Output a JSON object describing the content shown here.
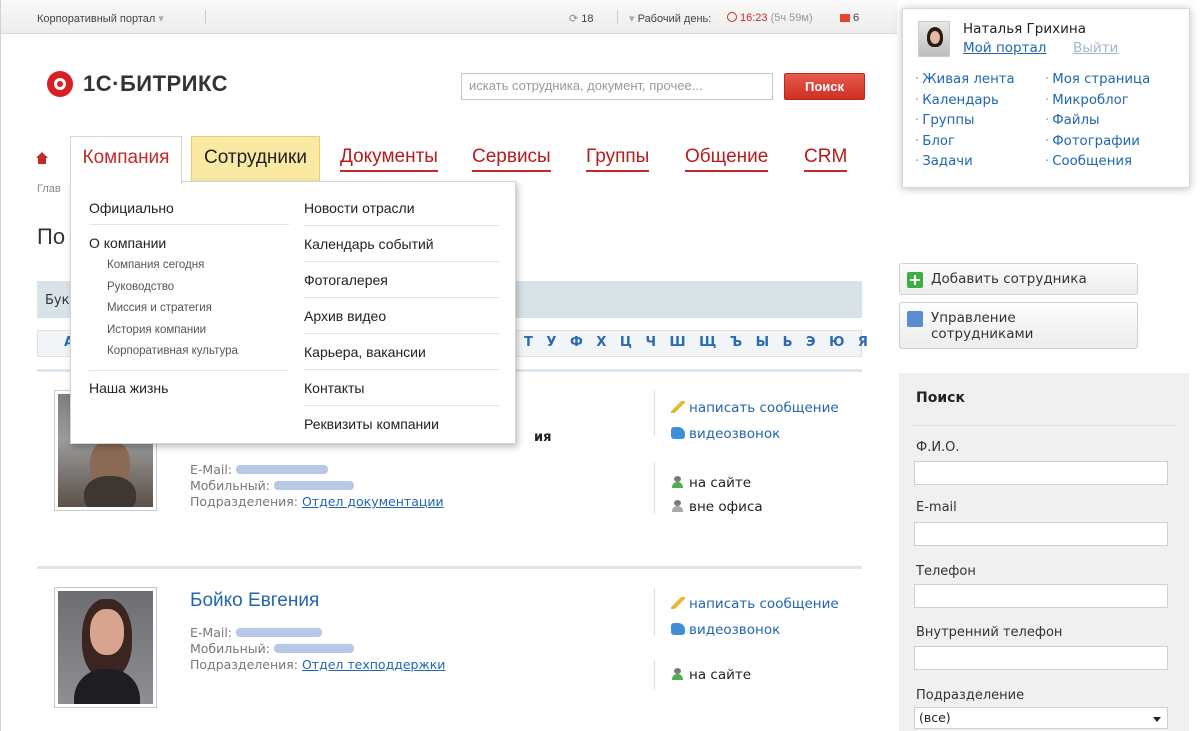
{
  "topbar": {
    "portal_menu": "Корпоративный портал",
    "counter": "18",
    "workday_label": "Рабочий день:",
    "time": "16:23",
    "time_extra": "(5ч 59м)",
    "flag_count": "6"
  },
  "logo": {
    "text": "1С·БИТРИКС"
  },
  "search": {
    "placeholder": "искать сотрудника, документ, прочее...",
    "button": "Поиск"
  },
  "nav": {
    "items": [
      {
        "label": "Компания"
      },
      {
        "label": "Сотрудники"
      },
      {
        "label": "Документы"
      },
      {
        "label": "Сервисы"
      },
      {
        "label": "Группы"
      },
      {
        "label": "Общение"
      },
      {
        "label": "CRM"
      }
    ]
  },
  "breadcrumb": "Глав",
  "page_title": "По",
  "alpha": {
    "label": "Бук",
    "first_letter": "А",
    "letters": "Т У Ф Х Ц Ч Ш Щ Ъ Ы Ь Э Ю Я"
  },
  "dropdown": {
    "col1": {
      "section1": "Официально",
      "section2": "О компании",
      "subitems": [
        "Компания сегодня",
        "Руководство",
        "Миссия и стратегия",
        "История компании",
        "Корпоративная культура"
      ],
      "section3": "Наша жизнь"
    },
    "col2": [
      "Новости отрасли",
      "Календарь событий",
      "Фотогалерея",
      "Архив видео",
      "Карьера, вакансии",
      "Контакты",
      "Реквизиты компании"
    ]
  },
  "employees": [
    {
      "name": "",
      "role_fragment": "ия",
      "email_label": "E-Mail:",
      "mobile_label": "Мобильный:",
      "dept_label": "Подразделения:",
      "dept": "Отдел документации",
      "action_message": "написать сообщение",
      "action_video": "видеозвонок",
      "status1": "на сайте",
      "status2": "вне офиса"
    },
    {
      "name": "Бойко Евгения",
      "email_label": "E-Mail:",
      "mobile_label": "Мобильный:",
      "dept_label": "Подразделения:",
      "dept": "Отдел техподдержки",
      "action_message": "написать сообщение",
      "action_video": "видеозвонок",
      "status1": "на сайте"
    }
  ],
  "user": {
    "name": "Наталья Грихина",
    "my_portal": "Мой портал",
    "logout": "Выйти",
    "menu_left": [
      "Живая лента",
      "Календарь",
      "Группы",
      "Блог",
      "Задачи"
    ],
    "menu_right": [
      "Моя страница",
      "Микроблог",
      "Файлы",
      "Фотографии",
      "Сообщения"
    ]
  },
  "buttons": {
    "add_employee": "Добавить сотрудника",
    "manage_employees_1": "Управление",
    "manage_employees_2": "сотрудниками"
  },
  "right_search": {
    "title": "Поиск",
    "fio": "Ф.И.О.",
    "email": "E-mail",
    "phone": "Телефон",
    "internal_phone": "Внутренний телефон",
    "department": "Подразделение",
    "department_value": "(все)"
  },
  "colors": {
    "accent_red": "#c62828",
    "link_blue": "#2067b0",
    "highlight_yellow": "#f9e9a3"
  }
}
